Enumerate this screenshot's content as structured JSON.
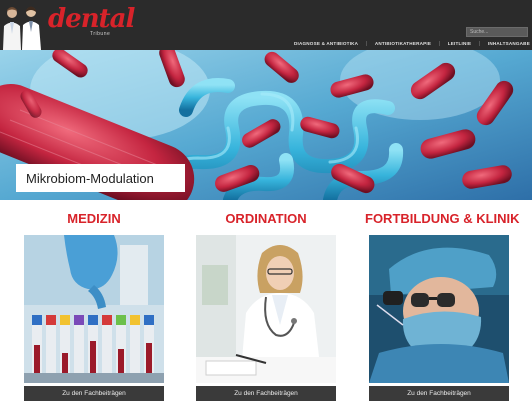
{
  "header": {
    "logo_text": "dental",
    "logo_sub": "Tribune",
    "search_placeholder": "Suche...",
    "nav": [
      "DIAGNOSE & ANTIBIOTIKA",
      "ANTIBIOTIKATHERAPIE",
      "LEITLINIE",
      "INHALTSANGABE"
    ]
  },
  "hero": {
    "caption": "Mikrobiom-Modulation"
  },
  "categories": [
    {
      "title": "MEDIZIN",
      "button": "Zu den Fachbeiträgen"
    },
    {
      "title": "ORDINATION",
      "button": "Zu den Fachbeiträgen"
    },
    {
      "title": "FORTBILDUNG & KLINIK",
      "button": "Zu den Fachbeiträgen"
    }
  ],
  "colors": {
    "brand_red": "#d8232a",
    "header_bg": "#2b2b2b",
    "button_bg": "#3a3a3a"
  }
}
